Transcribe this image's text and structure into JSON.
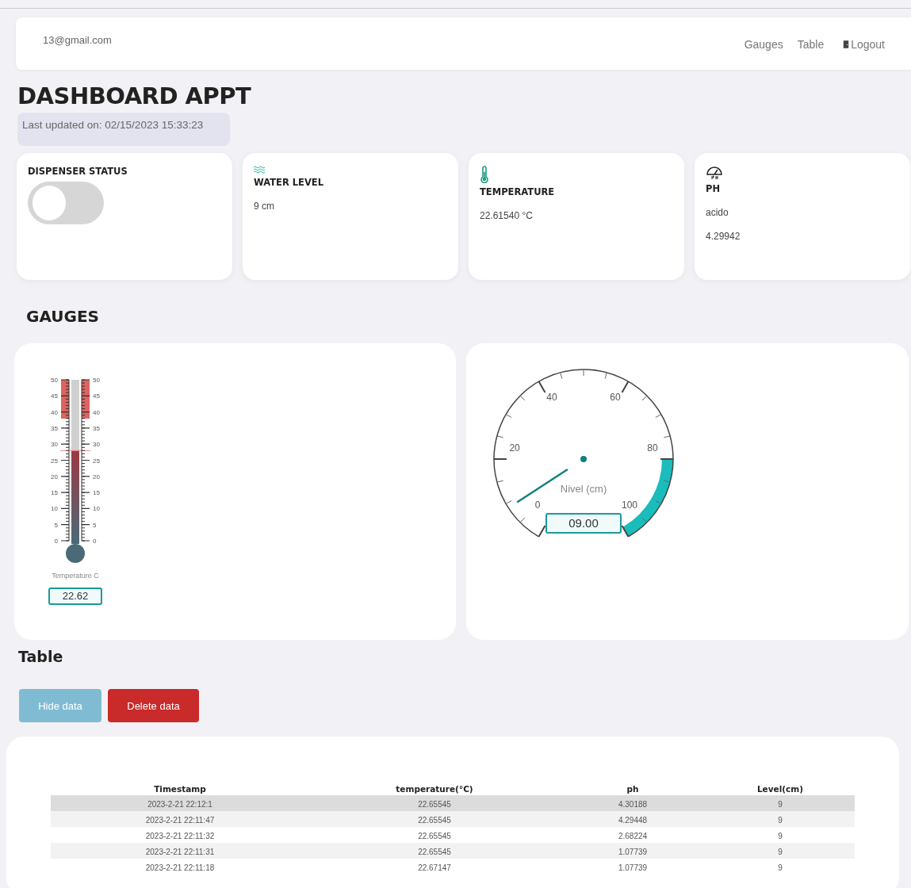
{
  "nav": {
    "user": "13@gmail.com",
    "links": [
      "Gauges",
      "Table"
    ],
    "logout": "Logout"
  },
  "title": "DASHBOARD APPT",
  "updated": "Last updated on: 02/15/2023 15:33:23",
  "cards": [
    {
      "kind": "toggle",
      "title": "DISPENSER STATUS",
      "on": false
    },
    {
      "kind": "water",
      "title": "WATER LEVEL",
      "lines": [
        "9 cm"
      ]
    },
    {
      "kind": "temperature",
      "title": "TEMPERATURE",
      "lines": [
        "22.61540 °C"
      ]
    },
    {
      "kind": "ph",
      "title": "PH",
      "lines": [
        "acido",
        "4.29942"
      ]
    }
  ],
  "gauges_title": "GAUGES",
  "thermometer": {
    "left_ticks": [
      "50",
      "45",
      "40",
      "35",
      "30",
      "25",
      "20",
      "15",
      "10",
      "5",
      "0"
    ],
    "right_ticks": [
      "50",
      "45",
      "40",
      "35",
      "30",
      "25",
      "20",
      "15",
      "10",
      "5",
      "0"
    ],
    "label": "Temperature C",
    "value": "22.62"
  },
  "dial": {
    "ticks": [
      "0",
      "20",
      "40",
      "60",
      "80",
      "100"
    ],
    "label": "Nivel (cm)",
    "value": "09.00"
  },
  "table_title": "Table",
  "buttons": [
    {
      "kind": "hide",
      "label": "Hide data",
      "disabled": true
    },
    {
      "kind": "delete",
      "label": "Delete data",
      "disabled": false
    }
  ],
  "table": {
    "columns": [
      "Timestamp",
      "temperature(°C)",
      "ph",
      "Level(cm)"
    ],
    "rows": [
      {
        "cells": [
          "2023-2-21 22:12:1",
          "22.65545",
          "4.30188",
          "9"
        ],
        "selected": true
      },
      {
        "cells": [
          "2023-2-21 22:11:47",
          "22.65545",
          "4.29448",
          "9"
        ],
        "selected": false
      },
      {
        "cells": [
          "2023-2-21 22:11:32",
          "22.65545",
          "2.68224",
          "9"
        ],
        "selected": false
      },
      {
        "cells": [
          "2023-2-21 22:11:31",
          "22.65545",
          "1.07739",
          "9"
        ],
        "selected": false
      },
      {
        "cells": [
          "2023-2-21 22:11:18",
          "22.67147",
          "1.07739",
          "9"
        ],
        "selected": false
      }
    ]
  }
}
